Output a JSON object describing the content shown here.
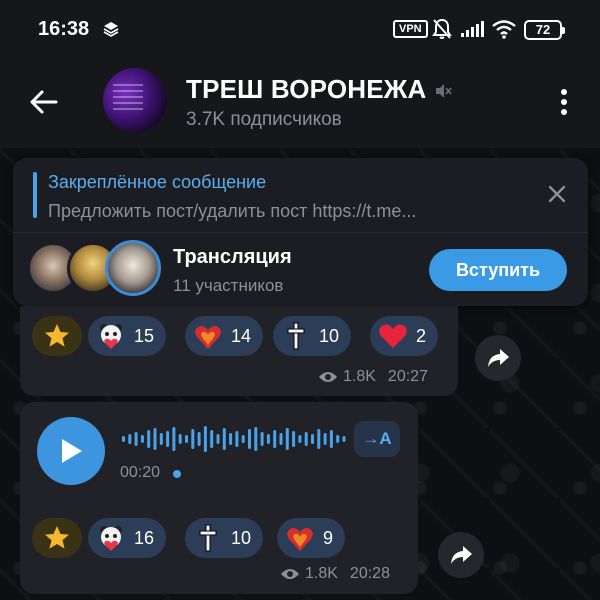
{
  "status_bar": {
    "time": "16:38",
    "vpn_label": "VPN",
    "battery": "72"
  },
  "header": {
    "channel_name": "ТРЕШ ВОРОНЕЖА",
    "subscribers": "3.7K подписчиков"
  },
  "pinned": {
    "title": "Закреплённое сообщение",
    "text": "Предложить пост/удалить пост https://t.me..."
  },
  "live_stream": {
    "title": "Трансляция",
    "participants": "11 участников",
    "join_label": "Вступить"
  },
  "message1": {
    "reactions": [
      {
        "icon": "star-icon",
        "count": ""
      },
      {
        "icon": "panda-heart-icon",
        "count": "15"
      },
      {
        "icon": "burning-heart-icon",
        "count": "14"
      },
      {
        "icon": "cross-icon",
        "count": "10"
      },
      {
        "icon": "red-heart-icon",
        "count": "2"
      }
    ],
    "views": "1.8K",
    "time": "20:27"
  },
  "message2": {
    "voice_duration": "00:20",
    "transcribe_label": "→A",
    "reactions": [
      {
        "icon": "star-icon",
        "count": ""
      },
      {
        "icon": "panda-heart-icon",
        "count": "16"
      },
      {
        "icon": "cross-icon",
        "count": "10"
      },
      {
        "icon": "burning-heart-icon",
        "count": "9"
      }
    ],
    "views": "1.8K",
    "time": "20:28"
  },
  "colors": {
    "accent": "#3b9ae6",
    "background": "#0f1013",
    "bubble": "#212227",
    "reaction_bg": "#2c3d57"
  }
}
